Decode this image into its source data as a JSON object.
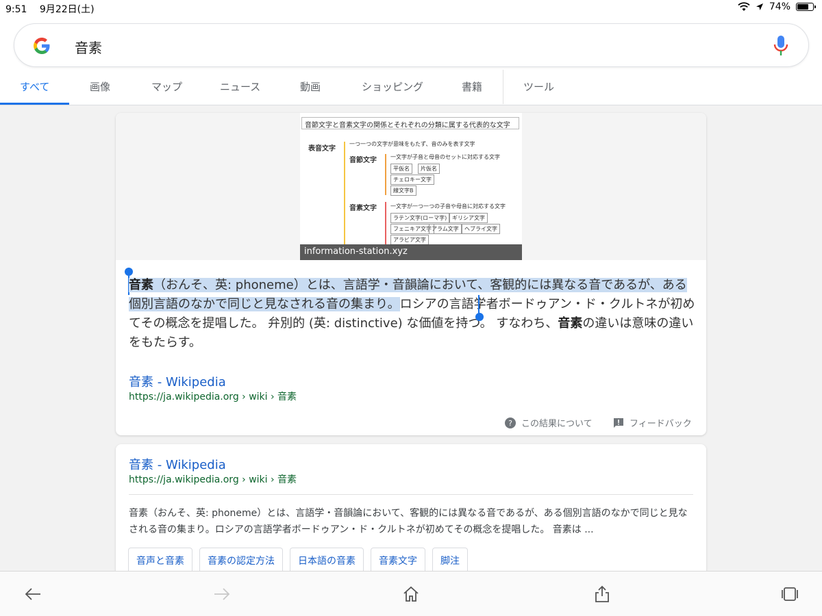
{
  "status": {
    "time": "9:51",
    "date": "9月22日(土)",
    "battery": "74%"
  },
  "search": {
    "query": "音素"
  },
  "tabs": [
    {
      "label": "すべて"
    },
    {
      "label": "画像"
    },
    {
      "label": "マップ"
    },
    {
      "label": "ニュース"
    },
    {
      "label": "動画"
    },
    {
      "label": "ショッピング"
    },
    {
      "label": "書籍"
    },
    {
      "label": "ツール"
    }
  ],
  "featured": {
    "image": {
      "title": "音節文字と音素文字の関係とそれぞれの分類に属する代表的な文字",
      "root": "表音文字",
      "root_desc": "一つ一つの文字が意味をもたず、音のみを表す文字",
      "syllabic": "音節文字",
      "syllabic_desc": "一文字が子音と母音のセットに対応する文字",
      "syllabic_items": [
        "平仮名",
        "片仮名",
        "チェロキー文字",
        "線文字B"
      ],
      "phonemic": "音素文字",
      "phonemic_desc": "一文字が一つ一つの子音や母音に対応する文字",
      "phonemic_items": [
        "ラテン文字(ローマ字)",
        "ギリシア文字",
        "フェニキア文字",
        "アラム文字",
        "ヘブライ文字",
        "アラビア文字"
      ],
      "caption": "information-station.xyz"
    },
    "snippet": {
      "term1": "音素",
      "part1": "（おんそ、英: phoneme）とは、言語学・音韻論において、客観的には異なる音であるが、ある個別言語のなかで同じと見なされる音の集まり。",
      "part2": "ロシアの言語学者ボードゥアン・ド・クルトネが初めてその概念を提唱した。 弁別的 (英: distinctive) な価値を持つ。 すなわち、",
      "term2": "音素",
      "part3": "の違いは意味の違いをもたらす。"
    },
    "source_title": "音素 - Wikipedia",
    "source_url": "https://ja.wikipedia.org › wiki › 音素",
    "about_label": "この結果について",
    "feedback_label": "フィードバック"
  },
  "result": {
    "title": "音素 - Wikipedia",
    "url": "https://ja.wikipedia.org › wiki › 音素",
    "snippet": "音素（おんそ、英: phoneme）とは、言語学・音韻論において、客観的には異なる音であるが、ある個別言語のなかで同じと見なされる音の集まり。ロシアの言語学者ボードゥアン・ド・クルトネが初めてその概念を提唱した。 音素は ...",
    "chips": [
      "音声と音素",
      "音素の認定方法",
      "日本語の音素",
      "音素文字",
      "脚注"
    ]
  },
  "colors": {
    "accent": "#1a73e8",
    "link": "#1a5fc8",
    "url": "#0d652d",
    "highlight": "#c9dcf2"
  },
  "toolbar": {
    "icons": [
      "back-arrow-icon",
      "forward-arrow-icon",
      "home-icon",
      "share-icon",
      "tabs-icon"
    ]
  }
}
